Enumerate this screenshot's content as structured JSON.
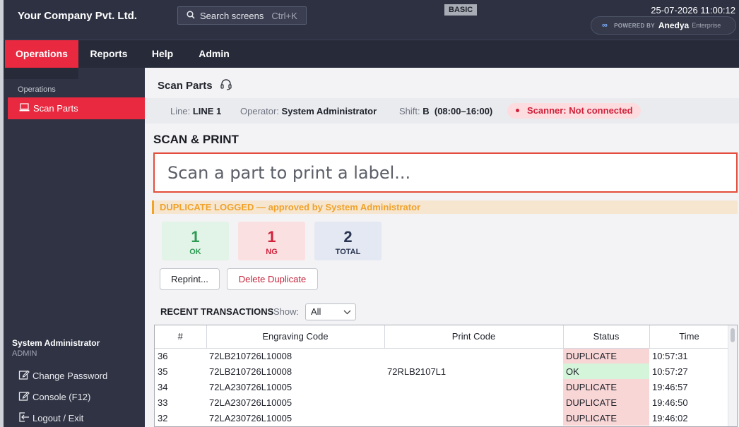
{
  "header": {
    "company": "Your Company Pvt. Ltd.",
    "search_label": "Search screens",
    "search_shortcut": "Ctrl+K",
    "plan_badge": "BASIC",
    "datetime": "25-07-2026 11:00:12",
    "powered_by": "POWERED BY",
    "powered_brand": "Anedya",
    "powered_tier": "Enterprise"
  },
  "nav": {
    "items": [
      "Operations",
      "Reports",
      "Help",
      "Admin"
    ],
    "active": "Operations"
  },
  "sidebar": {
    "group_label": "Operations",
    "active_item": "Scan Parts",
    "user_name": "System Administrator",
    "user_role": "ADMIN",
    "links": [
      "Change Password",
      "Console (F12)",
      "Logout / Exit"
    ]
  },
  "page": {
    "title": "Scan Parts",
    "line_label": "Line:",
    "line_value": "LINE 1",
    "operator_label": "Operator:",
    "operator_value": "System Administrator",
    "shift_label": "Shift:",
    "shift_value": "B",
    "shift_time": "(08:00–16:00)",
    "scanner_status": "Scanner: Not connected",
    "section_title": "SCAN & PRINT",
    "scan_placeholder": "Scan a part to print a label...",
    "banner": "DUPLICATE LOGGED — approved by System Administrator"
  },
  "stats": {
    "ok": {
      "value": "1",
      "label": "OK"
    },
    "ng": {
      "value": "1",
      "label": "NG"
    },
    "total": {
      "value": "2",
      "label": "TOTAL"
    }
  },
  "buttons": {
    "reprint": "Reprint...",
    "delete_duplicate": "Delete Duplicate"
  },
  "recent": {
    "title": "RECENT TRANSACTIONS",
    "show_label": "Show:",
    "show_value": "All",
    "columns": [
      "#",
      "Engraving Code",
      "Print Code",
      "Status",
      "Time"
    ],
    "rows": [
      {
        "num": "36",
        "engraving": "72LB210726L10008",
        "print": "",
        "status": "DUPLICATE",
        "time": "10:57:31"
      },
      {
        "num": "35",
        "engraving": "72LB210726L10008",
        "print": "72RLB2107L1",
        "status": "OK",
        "time": "10:57:27"
      },
      {
        "num": "34",
        "engraving": "72LA230726L10005",
        "print": "",
        "status": "DUPLICATE",
        "time": "19:46:57"
      },
      {
        "num": "33",
        "engraving": "72LA230726L10005",
        "print": "",
        "status": "DUPLICATE",
        "time": "19:46:50"
      },
      {
        "num": "32",
        "engraving": "72LA230726L10005",
        "print": "",
        "status": "DUPLICATE",
        "time": "19:46:02"
      }
    ]
  },
  "colors": {
    "accent": "#e8293f",
    "header_bg": "#2d3142",
    "sidebar_bg": "#2f3344",
    "ok_green": "#2e9a53",
    "ng_red": "#d0213a",
    "total_navy": "#2a3552",
    "warning_orange": "#f0a22a"
  }
}
